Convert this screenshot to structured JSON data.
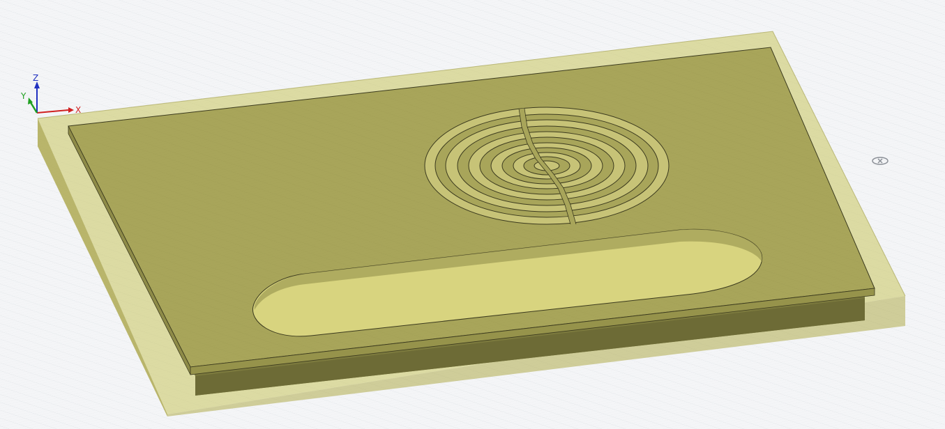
{
  "viewport": {
    "background": "#f4f5f7",
    "grid_color": "#c7ccd3",
    "model_color": "#a8a55a",
    "enclosure_color": "#c9c45f"
  },
  "triad": {
    "x_label": "X",
    "y_label": "Y",
    "z_label": "Z",
    "x_color": "#d02020",
    "y_color": "#20a020",
    "z_color": "#2030c0",
    "icons": [
      "x-axis-arrow-icon",
      "y-axis-arrow-icon",
      "z-axis-arrow-icon"
    ]
  },
  "orbit_marker": {
    "icon": "rotation-center-icon"
  }
}
